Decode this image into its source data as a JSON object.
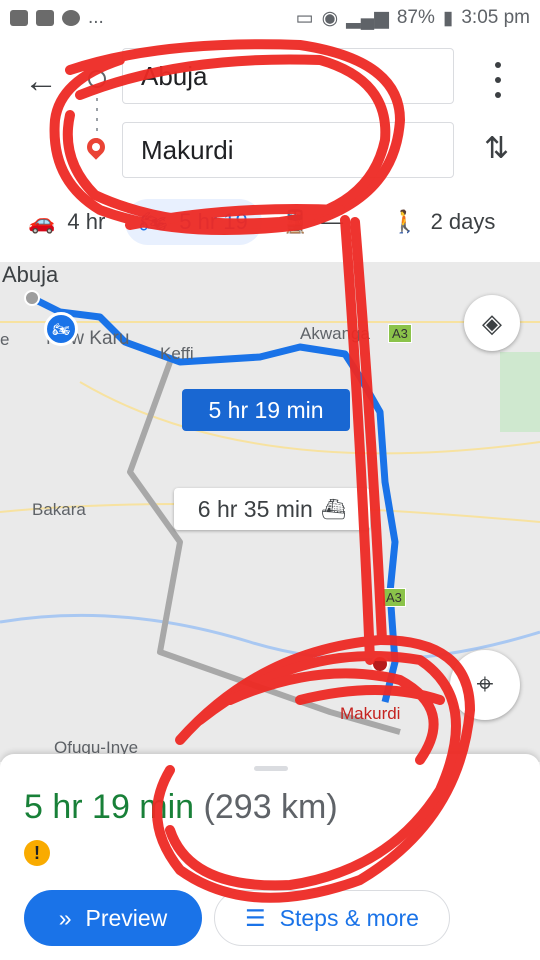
{
  "status_bar": {
    "left_extra": "...",
    "battery": "87%",
    "time": "3:05 pm"
  },
  "header": {
    "back_icon": "arrow-back-icon",
    "origin": "Abuja",
    "destination": "Makurdi",
    "swap_icon": "swap-vertical-icon"
  },
  "modes": [
    {
      "icon": "car-icon",
      "label": "4 hr"
    },
    {
      "icon": "motorcycle-icon",
      "label": "5 hr 19"
    },
    {
      "icon": "transit-icon",
      "label": "—"
    },
    {
      "icon": "walk-icon",
      "label": "2 days"
    }
  ],
  "map": {
    "labels": {
      "abuja": "Abuja",
      "new_karu": "New Karu",
      "keffi": "Keffi",
      "akwanga": "Akwanga",
      "bakara": "Bakara",
      "ofugu": "Ofugu-Inye",
      "makurdi": "Makurdi",
      "edge_e": "e"
    },
    "shields": {
      "a3_top": "A3",
      "a3_mid": "A3"
    },
    "route_time": "5 hr 19 min",
    "alt_time": "6 hr 35 min",
    "colors": {
      "route": "#1a73e8",
      "alt_route": "#a8a8a8",
      "scribble": "#ee2a24"
    }
  },
  "sheet": {
    "duration": "5 hr 19 min",
    "distance": "(293 km)",
    "preview_label": "Preview",
    "steps_label": "Steps & more"
  }
}
